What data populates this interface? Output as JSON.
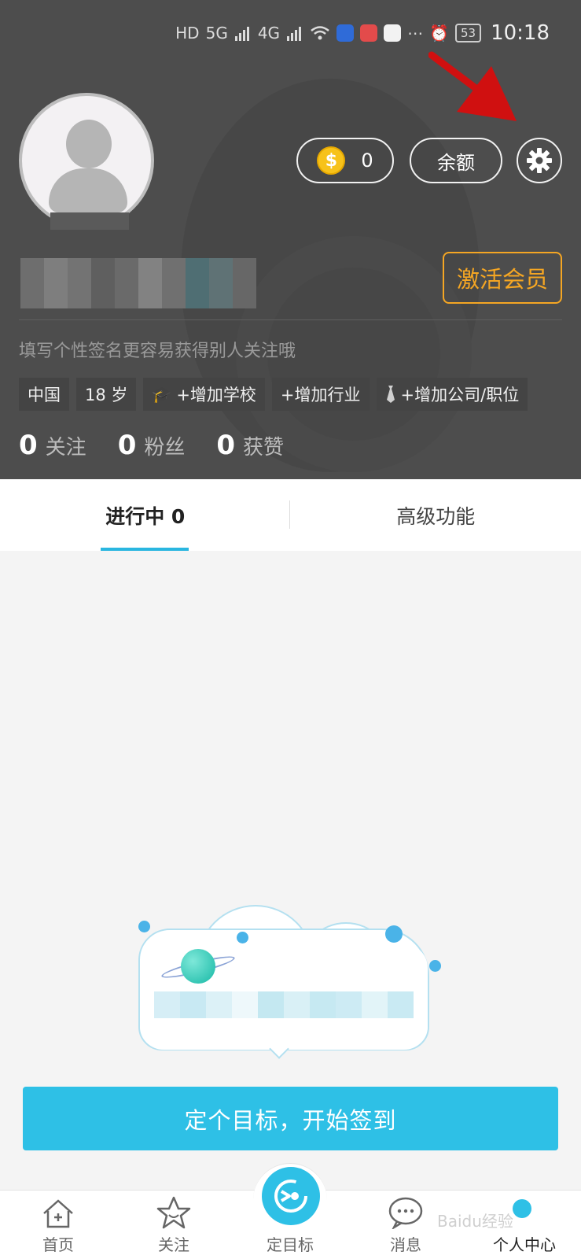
{
  "status_bar": {
    "time": "10:18",
    "battery": "53",
    "network_1": "HD",
    "network_2": "5G",
    "network_3": "4G"
  },
  "profile": {
    "coin_count": "0",
    "balance_label": "余额",
    "activate_label": "激活会员",
    "signature_placeholder": "填写个性签名更容易获得别人关注哦",
    "tags": [
      "中国",
      "18 岁",
      "+增加学校",
      "+增加行业",
      "+增加公司/职位"
    ],
    "stats": [
      {
        "num": "0",
        "label": "关注"
      },
      {
        "num": "0",
        "label": "粉丝"
      },
      {
        "num": "0",
        "label": "获赞"
      }
    ]
  },
  "tabs": [
    {
      "label": "进行中 0",
      "active": true
    },
    {
      "label": "高级功能",
      "active": false
    }
  ],
  "cta_label": "定个目标，开始签到",
  "bottom_nav": [
    {
      "label": "首页",
      "icon": "home-icon"
    },
    {
      "label": "关注",
      "icon": "star-icon"
    },
    {
      "label": "定目标",
      "icon": "target-icon"
    },
    {
      "label": "消息",
      "icon": "message-icon"
    },
    {
      "label": "个人中心",
      "icon": "profile-icon",
      "active": true
    }
  ],
  "watermark": "Baidu经验",
  "colors": {
    "accent": "#2ec0e6",
    "header_bg": "#4d4d4d",
    "activate": "#f5a623",
    "arrow": "#d01010"
  }
}
